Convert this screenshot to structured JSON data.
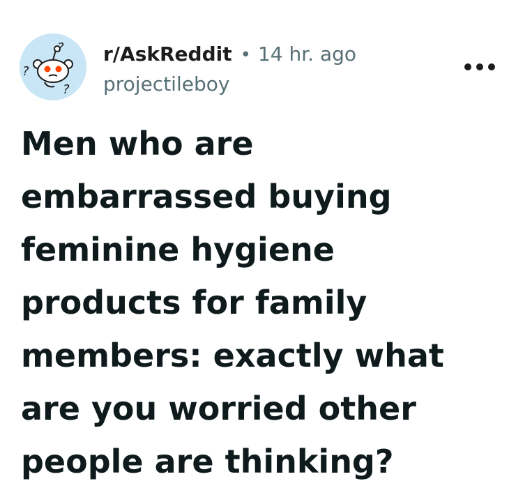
{
  "post": {
    "subreddit": "r/AskReddit",
    "separator": "•",
    "time": "14 hr. ago",
    "author": "projectileboy",
    "title": "Men who are embarrassed buying feminine hygiene products for family members: exactly what are you worried other people are thinking?"
  },
  "icons": {
    "avatar": "askreddit-snoo-icon",
    "overflow": "more-options-icon"
  },
  "colors": {
    "text": "#1c1c1c",
    "meta": "#576f76",
    "avatar_bg": "#c9e6f7",
    "snoo_orange": "#ff4500"
  }
}
